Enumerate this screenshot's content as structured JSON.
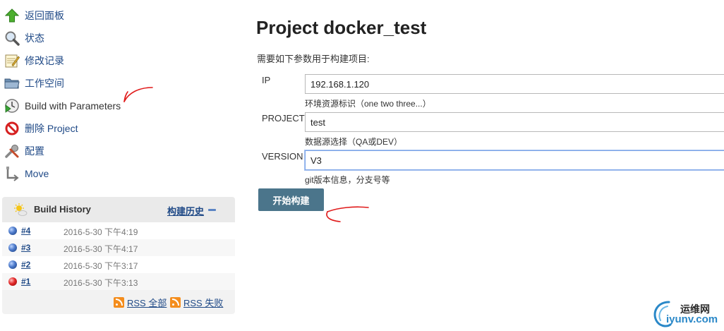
{
  "sidebar": {
    "items": [
      {
        "label": "返回面板",
        "icon": "up-arrow-icon"
      },
      {
        "label": "状态",
        "icon": "magnifier-icon"
      },
      {
        "label": "修改记录",
        "icon": "notepad-icon"
      },
      {
        "label": "工作空间",
        "icon": "folder-icon"
      },
      {
        "label": "Build with Parameters",
        "icon": "clock-play-icon"
      },
      {
        "label": "删除 Project",
        "icon": "no-entry-icon"
      },
      {
        "label": "配置",
        "icon": "wrench-icon"
      },
      {
        "label": "Move",
        "icon": "move-icon"
      }
    ]
  },
  "build_history": {
    "title": "Build History",
    "trend_link": "构建历史",
    "builds": [
      {
        "number": "#4",
        "date": "2016-5-30 下午4:19",
        "status": "blue"
      },
      {
        "number": "#3",
        "date": "2016-5-30 下午4:17",
        "status": "blue"
      },
      {
        "number": "#2",
        "date": "2016-5-30 下午3:17",
        "status": "blue"
      },
      {
        "number": "#1",
        "date": "2016-5-30 下午3:13",
        "status": "red"
      }
    ],
    "rss_all": "RSS 全部",
    "rss_failed": "RSS 失败"
  },
  "main": {
    "title": "Project docker_test",
    "intro": "需要如下参数用于构建项目:",
    "params": [
      {
        "name": "IP",
        "value": "192.168.1.120",
        "description": "环境资源标识（one two three...）"
      },
      {
        "name": "PROJECT",
        "value": "test",
        "description": "数据源选择（QA或DEV）"
      },
      {
        "name": "VERSION",
        "value": "V3",
        "description": "git版本信息，分支号等"
      }
    ],
    "submit_label": "开始构建"
  },
  "watermark": {
    "cn": "运维网",
    "en": "iyunv.com"
  },
  "colors": {
    "link": "#204a87",
    "submit_bg": "#4b758b",
    "annotation_red": "#e01b1b",
    "watermark_blue": "#2a88c8"
  }
}
